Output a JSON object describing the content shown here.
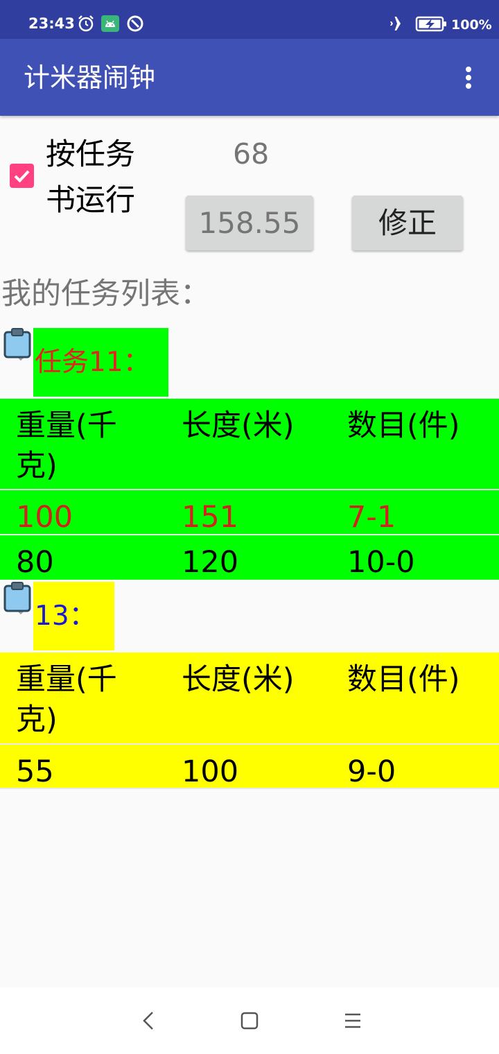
{
  "status_bar": {
    "time": "23:43",
    "battery": "100%",
    "icons": [
      "alarm-icon",
      "android-debug-icon",
      "data-saver-icon",
      "airplane-icon",
      "battery-charging-icon"
    ]
  },
  "app_bar": {
    "title": "计米器闹钟",
    "overflow_icon": "more-vert-icon"
  },
  "controls": {
    "run_by_task_label": "按任务书运行",
    "run_by_task_checked": true,
    "count_value": "68",
    "meter_value": "158.55",
    "correct_label": "修正"
  },
  "section_title": "我的任务列表：",
  "tasks": [
    {
      "title": "任务11：",
      "bg_color": "#00ff00",
      "title_color": "#e52222",
      "icon": "clipboard-icon",
      "headers": [
        "重量(千克)",
        "长度(米)",
        "数目(件)"
      ],
      "rows": [
        {
          "cells": [
            "100",
            "151",
            "7-1"
          ],
          "color": "#d32020"
        },
        {
          "cells": [
            "80",
            "120",
            "10-0"
          ],
          "color": "#000000"
        }
      ]
    },
    {
      "title": "13：",
      "bg_color": "#ffff00",
      "title_color": "#1a1ad6",
      "icon": "clipboard-icon",
      "headers": [
        "重量(千克)",
        "长度(米)",
        "数目(件)"
      ],
      "rows": [
        {
          "cells": [
            "55",
            "100",
            "9-0"
          ],
          "color": "#000000"
        }
      ]
    }
  ],
  "nav_bar": {
    "icons": [
      "back-icon",
      "home-icon",
      "recents-icon"
    ]
  }
}
